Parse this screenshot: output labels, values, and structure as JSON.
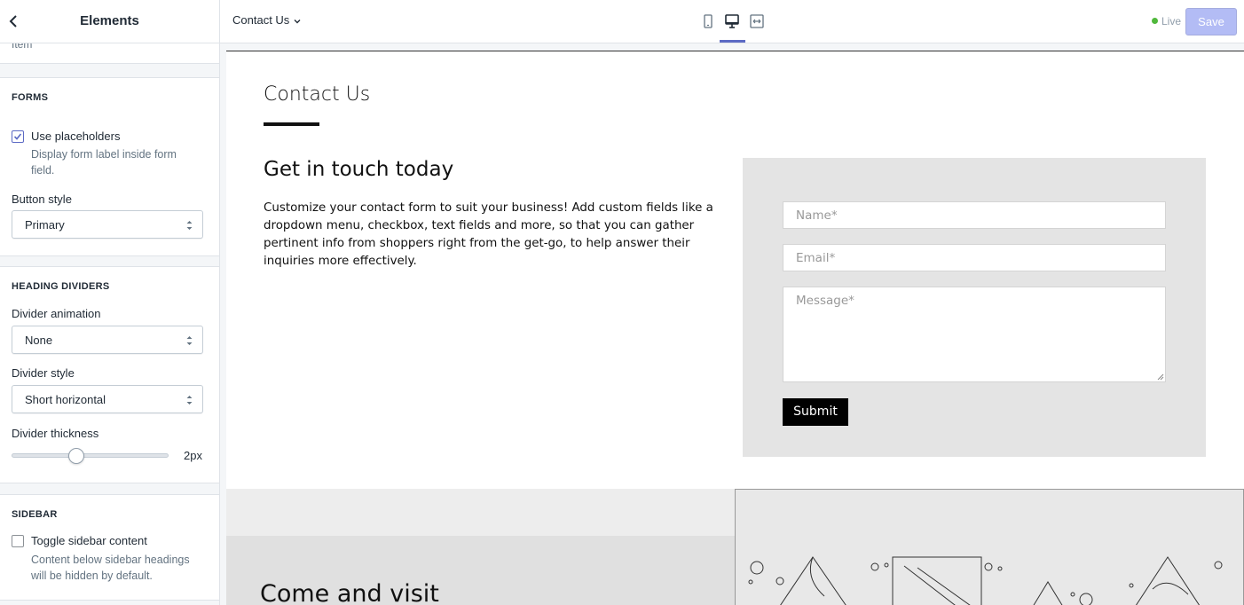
{
  "sidebar": {
    "title": "Elements",
    "top_fragment": "Item",
    "forms": {
      "heading": "FORMS",
      "use_placeholders_label": "Use placeholders",
      "use_placeholders_checked": true,
      "use_placeholders_help": "Display form label inside form field.",
      "button_style_label": "Button style",
      "button_style_value": "Primary"
    },
    "heading_dividers": {
      "heading": "HEADING DIVIDERS",
      "animation_label": "Divider animation",
      "animation_value": "None",
      "style_label": "Divider style",
      "style_value": "Short horizontal",
      "thickness_label": "Divider thickness",
      "thickness_value": "2px",
      "thickness_fraction": 0.41
    },
    "sidebar_section": {
      "heading": "SIDEBAR",
      "toggle_label": "Toggle sidebar content",
      "toggle_checked": false,
      "toggle_help": "Content below sidebar headings will be hidden by default."
    }
  },
  "topbar": {
    "page_select": "Contact Us",
    "live_label": "Live",
    "save_label": "Save",
    "active_view": "desktop"
  },
  "preview": {
    "section_title": "Contact Us",
    "touch_heading": "Get in touch today",
    "touch_text": "Customize your contact form to suit your business! Add custom fields like a dropdown menu, checkbox, text fields and more, so that you can gather pertinent info from shoppers right from the get-go, to help answer their inquiries more effectively.",
    "form": {
      "name_placeholder": "Name*",
      "email_placeholder": "Email*",
      "message_placeholder": "Message*",
      "submit_label": "Submit"
    },
    "visit_heading": "Come and visit"
  },
  "colors": {
    "accent": "#5c6ac4",
    "save_disabled": "#b3bcf5",
    "live_dot": "#50b83c"
  }
}
